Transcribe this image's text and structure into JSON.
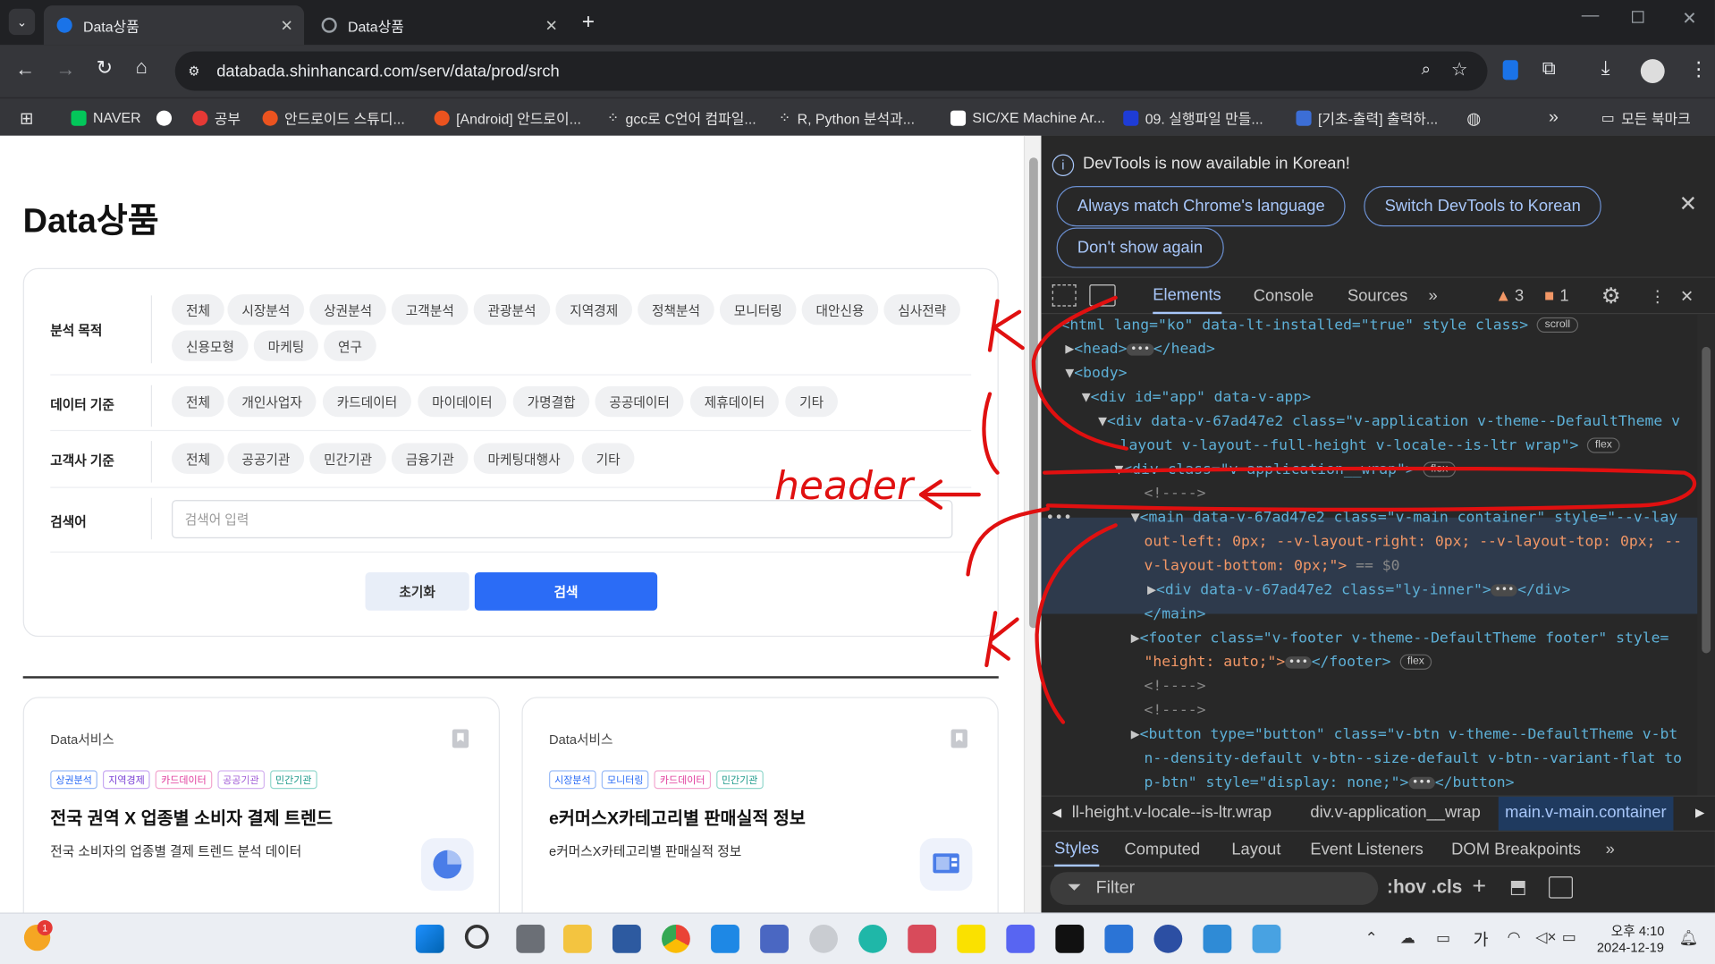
{
  "browser": {
    "tabs": [
      {
        "title": "Data상품",
        "active": true
      },
      {
        "title": "Data상품",
        "active": false
      }
    ],
    "url": "databada.shinhancard.com/serv/data/prod/srch",
    "bookmarks": [
      "NAVER",
      "공부",
      "안드로이드 스튜디...",
      "[Android] 안드로이...",
      "gcc로 C언어 컴파일...",
      "R, Python 분석과...",
      "SIC/XE Machine Ar...",
      "09. 실행파일 만들...",
      "[기초-출력] 출력하..."
    ],
    "bookmark_folder": "모든 북마크"
  },
  "page": {
    "title": "Data상품",
    "filters": {
      "purpose_label": "분석 목적",
      "purpose_options": [
        "전체",
        "시장분석",
        "상권분석",
        "고객분석",
        "관광분석",
        "지역경제",
        "정책분석",
        "모니터링",
        "대안신용",
        "심사전략",
        "신용모형",
        "마케팅",
        "연구"
      ],
      "data_label": "데이터 기준",
      "data_options": [
        "전체",
        "개인사업자",
        "카드데이터",
        "마이데이터",
        "가명결합",
        "공공데이터",
        "제휴데이터",
        "기타"
      ],
      "customer_label": "고객사 기준",
      "customer_options": [
        "전체",
        "공공기관",
        "민간기관",
        "금융기관",
        "마케팅대행사",
        "기타"
      ],
      "search_label": "검색어",
      "search_placeholder": "검색어 입력",
      "reset_label": "초기화",
      "search_button": "검색"
    },
    "cards": [
      {
        "category": "Data서비스",
        "tags": [
          "상권분석",
          "지역경제",
          "카드데이터",
          "공공기관",
          "민간기관"
        ],
        "title": "전국 권역 X 업종별 소비자 결제 트렌드",
        "desc": "전국 소비자의 업종별 결제 트렌드 분석 데이터"
      },
      {
        "category": "Data서비스",
        "tags": [
          "시장분석",
          "모니터링",
          "카드데이터",
          "민간기관"
        ],
        "title": "e커머스X카테고리별 판매실적 정보",
        "desc": "e커머스X카테고리별 판매실적 정보"
      }
    ]
  },
  "devtools": {
    "info_text": "DevTools is now available in Korean!",
    "btn_match": "Always match Chrome's language",
    "btn_switch": "Switch DevTools to Korean",
    "btn_dont_show": "Don't show again",
    "tabs": [
      "Elements",
      "Console",
      "Sources"
    ],
    "warnings": "3",
    "errors": "1",
    "breadcrumbs": [
      "ll-height.v-locale--is-ltr.wrap",
      "div.v-application__wrap",
      "main.v-main.container"
    ],
    "sub_tabs": [
      "Styles",
      "Computed",
      "Layout",
      "Event Listeners",
      "DOM Breakpoints"
    ],
    "filter_placeholder": "Filter",
    "hov_cls": ":hov .cls",
    "badges": {
      "scroll": "scroll",
      "flex": "flex",
      "sel_ref": "== $0"
    },
    "code": {
      "l1": "<html lang=\"ko\" data-lt-installed=\"true\" style class>",
      "l2a": "<head>",
      "l2b": "</head>",
      "l3": "<body>",
      "l4": "<div id=\"app\" data-v-app>",
      "l5": "<div data-v-67ad47e2 class=\"v-application v-theme--DefaultTheme v",
      "l6": "-layout v-layout--full-height v-locale--is-ltr wrap\">",
      "l7": "<div class=\"v-application__wrap\">",
      "l8": "<!---->",
      "l9": "<main data-v-67ad47e2 class=\"v-main container\" style=\"--v-lay",
      "l10": "out-left: 0px; --v-layout-right: 0px; --v-layout-top: 0px; --",
      "l11": "v-layout-bottom: 0px;\">",
      "l12a": "<div data-v-67ad47e2 class=\"ly-inner\">",
      "l12b": "</div>",
      "l13": "</main>",
      "l14a": "<footer class=\"v-footer v-theme--DefaultTheme footer\" style=",
      "l15a": "\"height: auto;\">",
      "l15b": "</footer>",
      "l16": "<!---->",
      "l17": "<!---->",
      "l18": "<button type=\"button\" class=\"v-btn v-theme--DefaultTheme v-bt",
      "l19": "n--density-default v-btn--size-default v-btn--variant-flat to",
      "l20a": "p-btn\" style=\"display: none;\">",
      "l20b": "</button>"
    }
  },
  "annotation": {
    "text": "header"
  },
  "taskbar": {
    "time": "오후 4:10",
    "date": "2024-12-19",
    "ime": "가",
    "notif_count": "1"
  }
}
